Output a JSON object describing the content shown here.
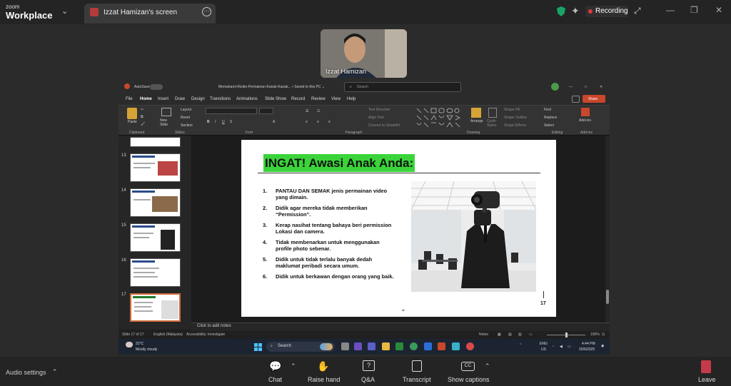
{
  "app": {
    "brand_line1": "zoom",
    "brand_line2": "Workplace"
  },
  "tab": {
    "title": "Izzat Hamizan's screen"
  },
  "recording": {
    "label": "Recording"
  },
  "participant": {
    "name": "Izzat Hamizan"
  },
  "powerpoint": {
    "autosave": "AutoSave",
    "file_title": "Memahami-Risiko-Permainan-Kanak-Kanak... • Saved to this PC ⌄",
    "search_placeholder": "Search",
    "share_label": "Share",
    "menu": [
      "File",
      "Home",
      "Insert",
      "Draw",
      "Design",
      "Transitions",
      "Animations",
      "Slide Show",
      "Record",
      "Review",
      "View",
      "Help"
    ],
    "ribbon_groups": [
      "Clipboard",
      "Slides",
      "Font",
      "Paragraph",
      "Drawing",
      "Editing",
      "Add-ins"
    ],
    "ribbon_buttons": {
      "paste": "Paste",
      "new_slide": "New Slide",
      "layout": "Layout",
      "reset": "Reset",
      "section": "Section",
      "text_direction": "Text Direction",
      "align_text": "Align Text",
      "convert_smartart": "Convert to SmartArt",
      "arrange": "Arrange",
      "quick_styles": "Quick Styles",
      "shape_fill": "Shape Fill",
      "shape_outline": "Shape Outline",
      "shape_effects": "Shape Effects",
      "find": "Find",
      "replace": "Replace",
      "select": "Select",
      "addins": "Add-ins"
    },
    "thumbnail_numbers": [
      "13",
      "14",
      "15",
      "16",
      "17"
    ],
    "slide": {
      "title": "INGAT! Awasi Anak Anda:",
      "items": [
        {
          "num": "1.",
          "text": "PANTAU DAN SEMAK jenis permainan video yang dimain."
        },
        {
          "num": "2.",
          "text": "Didik agar mereka tidak memberikan “Permission”."
        },
        {
          "num": "3.",
          "text": "Kerap nasihat tentang bahaya beri permission Lokasi dan camera."
        },
        {
          "num": "4.",
          "text": "Tidak membenarkan untuk menggunakan profile photo sebenar."
        },
        {
          "num": "5.",
          "text": "Didik untuk tidak terlalu banyak dedah maklumat peribadi secara umum."
        },
        {
          "num": "6.",
          "text": "Didik untuk berkawan dengan orang yang baik."
        }
      ],
      "number": "17"
    },
    "notes_placeholder": "Click to add notes",
    "status": {
      "slide_count": "Slide 17 of 17",
      "language": "English (Malaysia)",
      "accessibility": "Accessibility: Investigate",
      "notes": "Notes",
      "zoom": "100%"
    }
  },
  "windows_taskbar": {
    "weather_temp": "31°C",
    "weather_desc": "Mostly cloudy",
    "search": "Search",
    "lang1": "ENG",
    "lang2": "US",
    "time": "4:44 PM",
    "date": "20/6/2025"
  },
  "controls": {
    "audio_settings": "Audio settings",
    "chat": "Chat",
    "raise_hand": "Raise hand",
    "qa": "Q&A",
    "transcript": "Transcript",
    "show_captions": "Show captions",
    "leave": "Leave"
  },
  "colors": {
    "accent_green": "#3ad43a",
    "record_red": "#e0363d",
    "leave_red": "#c53a4a"
  }
}
